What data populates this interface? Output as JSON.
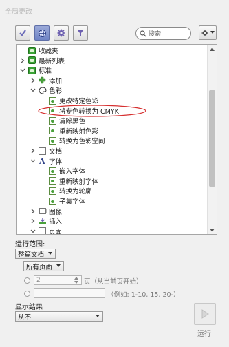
{
  "panel": {
    "title": "全局更改"
  },
  "toolbar": {
    "buttons": [
      {
        "icon": "checkmark-icon",
        "active": false
      },
      {
        "icon": "globe-icon",
        "active": true
      },
      {
        "icon": "gear-icon",
        "active": false
      },
      {
        "icon": "funnel-icon",
        "active": false
      }
    ],
    "search_placeholder": "搜索"
  },
  "tree": {
    "items": [
      {
        "label": "收藏夹",
        "level": 0,
        "twisty": "none",
        "icon": "green"
      },
      {
        "label": "最新列表",
        "level": 0,
        "twisty": "closed",
        "icon": "green"
      },
      {
        "label": "标准",
        "level": 0,
        "twisty": "open",
        "icon": "green"
      },
      {
        "label": "添加",
        "level": 1,
        "twisty": "closed",
        "icon": "plus"
      },
      {
        "label": "色彩",
        "level": 1,
        "twisty": "open",
        "icon": "palette"
      },
      {
        "label": "更改特定色彩",
        "level": 2,
        "twisty": "none",
        "icon": "page"
      },
      {
        "label": "将专色转换为 CMYK",
        "level": 2,
        "twisty": "none",
        "icon": "page",
        "circled": true
      },
      {
        "label": "清除黑色",
        "level": 2,
        "twisty": "none",
        "icon": "page"
      },
      {
        "label": "重新映射色彩",
        "level": 2,
        "twisty": "none",
        "icon": "page"
      },
      {
        "label": "转换为色彩空间",
        "level": 2,
        "twisty": "none",
        "icon": "page"
      },
      {
        "label": "文档",
        "level": 1,
        "twisty": "closed",
        "icon": "doc"
      },
      {
        "label": "字体",
        "level": 1,
        "twisty": "open",
        "icon": "font"
      },
      {
        "label": "嵌入字体",
        "level": 2,
        "twisty": "none",
        "icon": "page"
      },
      {
        "label": "重新映射字体",
        "level": 2,
        "twisty": "none",
        "icon": "page"
      },
      {
        "label": "转换为轮廓",
        "level": 2,
        "twisty": "none",
        "icon": "page"
      },
      {
        "label": "子集字体",
        "level": 2,
        "twisty": "none",
        "icon": "page"
      },
      {
        "label": "图像",
        "level": 1,
        "twisty": "closed",
        "icon": "image"
      },
      {
        "label": "插入",
        "level": 1,
        "twisty": "closed",
        "icon": "insert"
      },
      {
        "label": "页面",
        "level": 1,
        "twisty": "open",
        "icon": "doc"
      }
    ]
  },
  "run_range": {
    "label": "运行范围:",
    "scope_value": "整篇文档",
    "pages_value": "所有页面",
    "spin_value": "2",
    "from_page_text": "页（从当前页开始）",
    "example_text": "（例如: 1-10, 15, 20-）"
  },
  "results": {
    "label": "显示结果",
    "value": "从不"
  },
  "run_button": {
    "label": "运行"
  },
  "colors": {
    "accent": "#6f84c6",
    "circle": "#d63030"
  }
}
